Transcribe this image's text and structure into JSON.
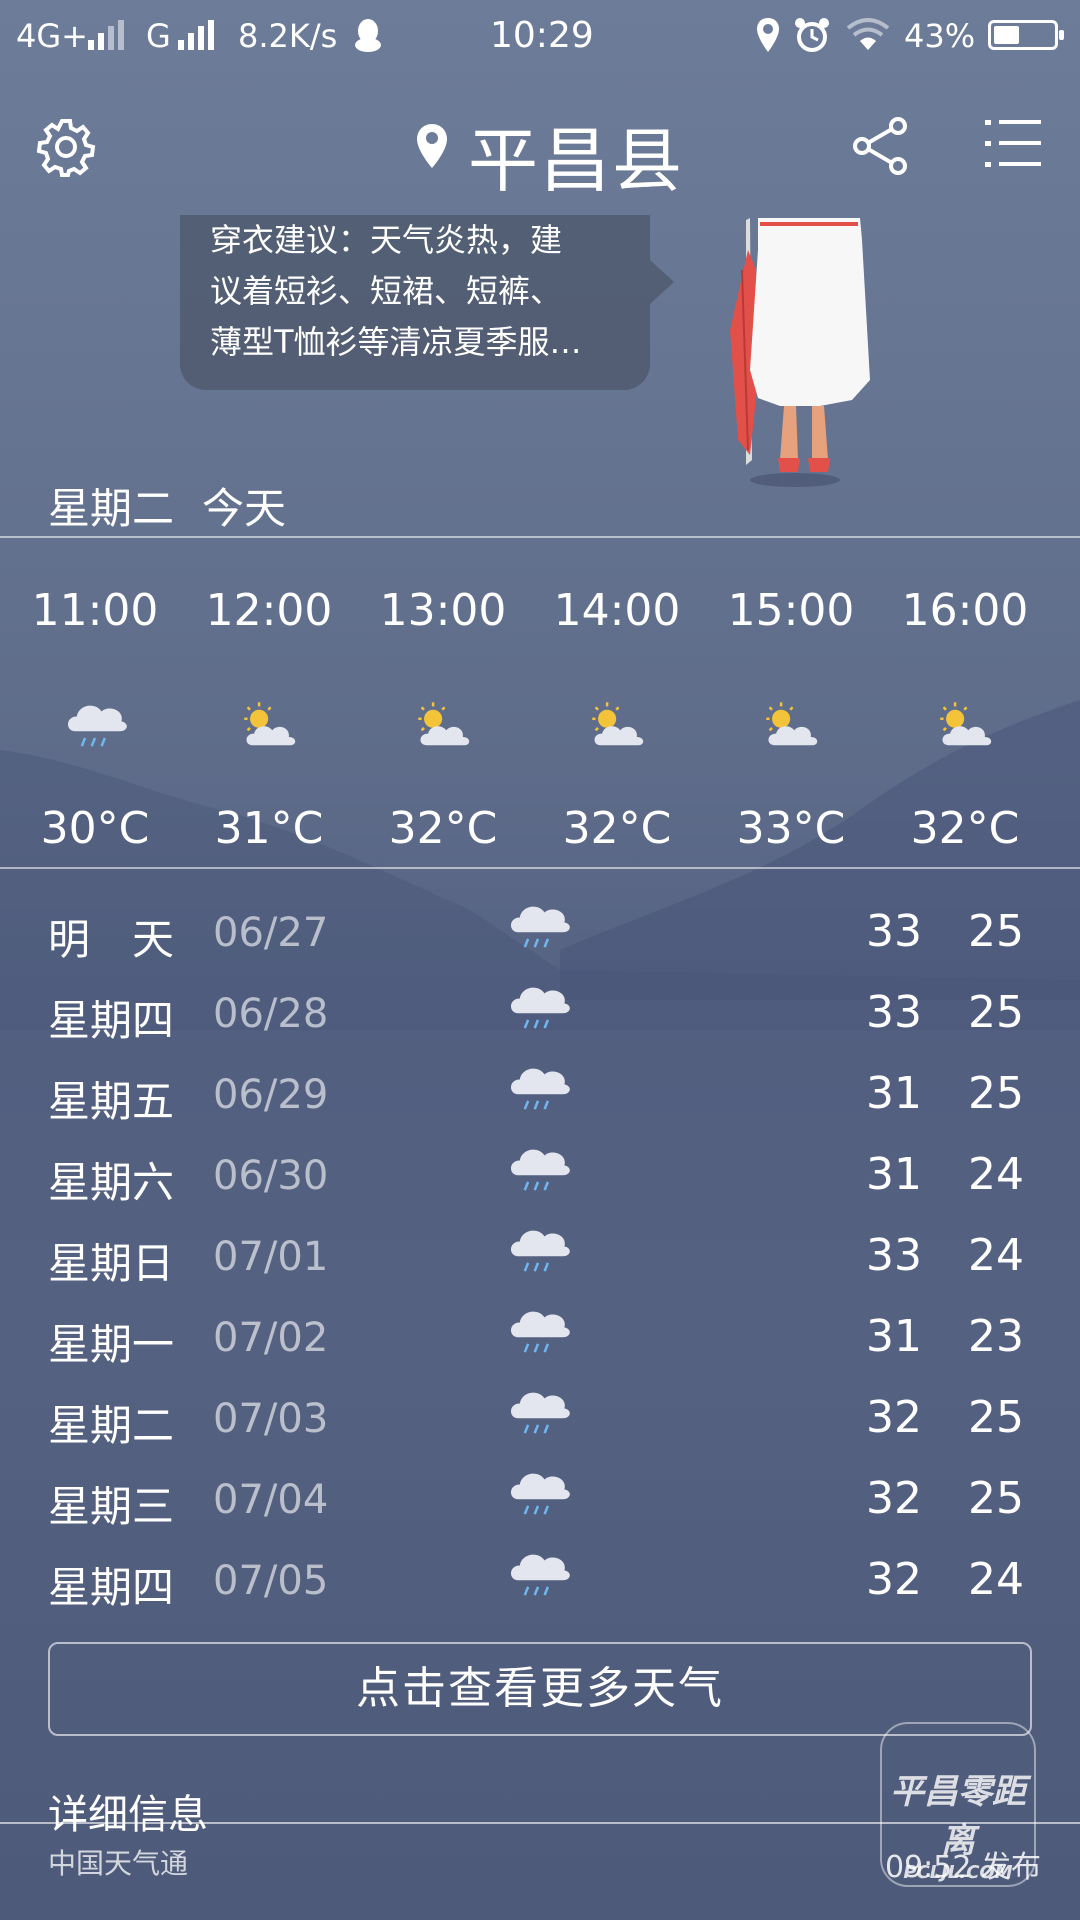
{
  "status_bar": {
    "network": "4G+",
    "network2": "G",
    "speed": "8.2K/s",
    "time": "10:29",
    "battery": "43%",
    "battery_level": 0.43
  },
  "header": {
    "city": "平昌县"
  },
  "advice": {
    "text_line1": "穿衣建议：天气炎热，建",
    "text_line2": "议着短衫、短裙、短裤、",
    "text_line3": "薄型T恤衫等清凉夏季服…"
  },
  "today": {
    "weekday": "星期二",
    "label": "今天"
  },
  "hourly": [
    {
      "time": "11:00",
      "icon": "rain-cloud-icon",
      "temp": "30°C"
    },
    {
      "time": "12:00",
      "icon": "sun-cloud-icon",
      "temp": "31°C"
    },
    {
      "time": "13:00",
      "icon": "sun-cloud-icon",
      "temp": "32°C"
    },
    {
      "time": "14:00",
      "icon": "sun-cloud-icon",
      "temp": "32°C"
    },
    {
      "time": "15:00",
      "icon": "sun-cloud-icon",
      "temp": "33°C"
    },
    {
      "time": "16:00",
      "icon": "sun-cloud-icon",
      "temp": "32°C"
    }
  ],
  "daily": [
    {
      "name": "明　天",
      "date": "06/27",
      "icon": "rain-cloud-icon",
      "high": "33",
      "low": "25"
    },
    {
      "name": "星期四",
      "date": "06/28",
      "icon": "rain-cloud-icon",
      "high": "33",
      "low": "25"
    },
    {
      "name": "星期五",
      "date": "06/29",
      "icon": "rain-cloud-icon",
      "high": "31",
      "low": "25"
    },
    {
      "name": "星期六",
      "date": "06/30",
      "icon": "rain-cloud-icon",
      "high": "31",
      "low": "24"
    },
    {
      "name": "星期日",
      "date": "07/01",
      "icon": "rain-cloud-icon",
      "high": "33",
      "low": "24"
    },
    {
      "name": "星期一",
      "date": "07/02",
      "icon": "rain-cloud-icon",
      "high": "31",
      "low": "23"
    },
    {
      "name": "星期二",
      "date": "07/03",
      "icon": "rain-cloud-icon",
      "high": "32",
      "low": "25"
    },
    {
      "name": "星期三",
      "date": "07/04",
      "icon": "rain-cloud-icon",
      "high": "32",
      "low": "25"
    },
    {
      "name": "星期四",
      "date": "07/05",
      "icon": "rain-cloud-icon",
      "high": "32",
      "low": "24"
    }
  ],
  "more_button": "点击查看更多天气",
  "details": {
    "title": "详细信息",
    "source": "中国天气通",
    "published": "09:52 发布"
  },
  "watermark": {
    "line1": "平昌零距离",
    "line2": "PCLJL.COM"
  }
}
